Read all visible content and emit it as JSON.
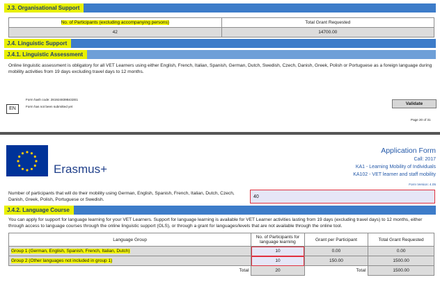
{
  "section_j3": {
    "title": "J.3. Organisational Support",
    "col1": "No. of Participants (excluding accompanying persons)",
    "col2": "Total Grant Requested",
    "participants": "42",
    "grant": "14700.00"
  },
  "section_j4": {
    "title": "J.4. Linguistic Support",
    "sub_title": "J.4.1. Linguistic Assessment",
    "paragraph": "Online linguistic assessment is obligatory for all VET Learners using either English, French, Italian, Spanish, German, Dutch, Swedish, Czech, Danish, Greek, Polish or Portuguese as a foreign language during mobility activities from 19 days excluding travel days to 12 months."
  },
  "footer": {
    "hash": "Form hash code: 281924839B432E1",
    "status": "Form has not been submitted yet",
    "lang": "EN",
    "validate": "Validate",
    "page": "Page 20 of 31"
  },
  "header": {
    "brand": "Erasmus+",
    "form_title": "Application Form",
    "call": "Call: 2017",
    "ka1": "KA1 - Learning Mobility of Individuals",
    "ka102": "KA102 - VET learner and staff mobility",
    "version": "Form Version: 4.05"
  },
  "participants_question": {
    "label": "Number of participants that will do their mobility using German, English, Spanish, French, Italian, Dutch, Czech, Danish, Greek, Polish, Portuguese or Swedish.",
    "value": "40"
  },
  "section_j42": {
    "title": "J.4.2. Language Course",
    "paragraph": "You can apply for support for language learning for your VET Learners. Support for language learning is available for VET Learner activities lasting from 19 days (excluding travel days) to 12 months, either through access to language courses through the online linguistic support (OLS), or through a grant for languages/levels that are not available through the online tool."
  },
  "language_table": {
    "headers": [
      "Language Group",
      "No. of Participants for language learning",
      "Grant per Participant",
      "Total Grant Requested"
    ],
    "rows": [
      {
        "group": "Group 1 (German, English, Spanish, French, Italian, Dutch)",
        "participants": "10",
        "per": "0.00",
        "total": "0.00"
      },
      {
        "group": "Group 2 (Other languages not included in group 1)",
        "participants": "10",
        "per": "150.00",
        "total": "1500.00"
      }
    ],
    "total_label": "Total",
    "total_participants": "20",
    "total_label2": "Total",
    "total_grant": "1500.00"
  },
  "colors": {
    "accent_blue": "#3d7cc9",
    "highlight": "#f3f500",
    "red_outline": "#e0303e",
    "eu_blue": "#003399",
    "eu_gold": "#ffcc00"
  }
}
